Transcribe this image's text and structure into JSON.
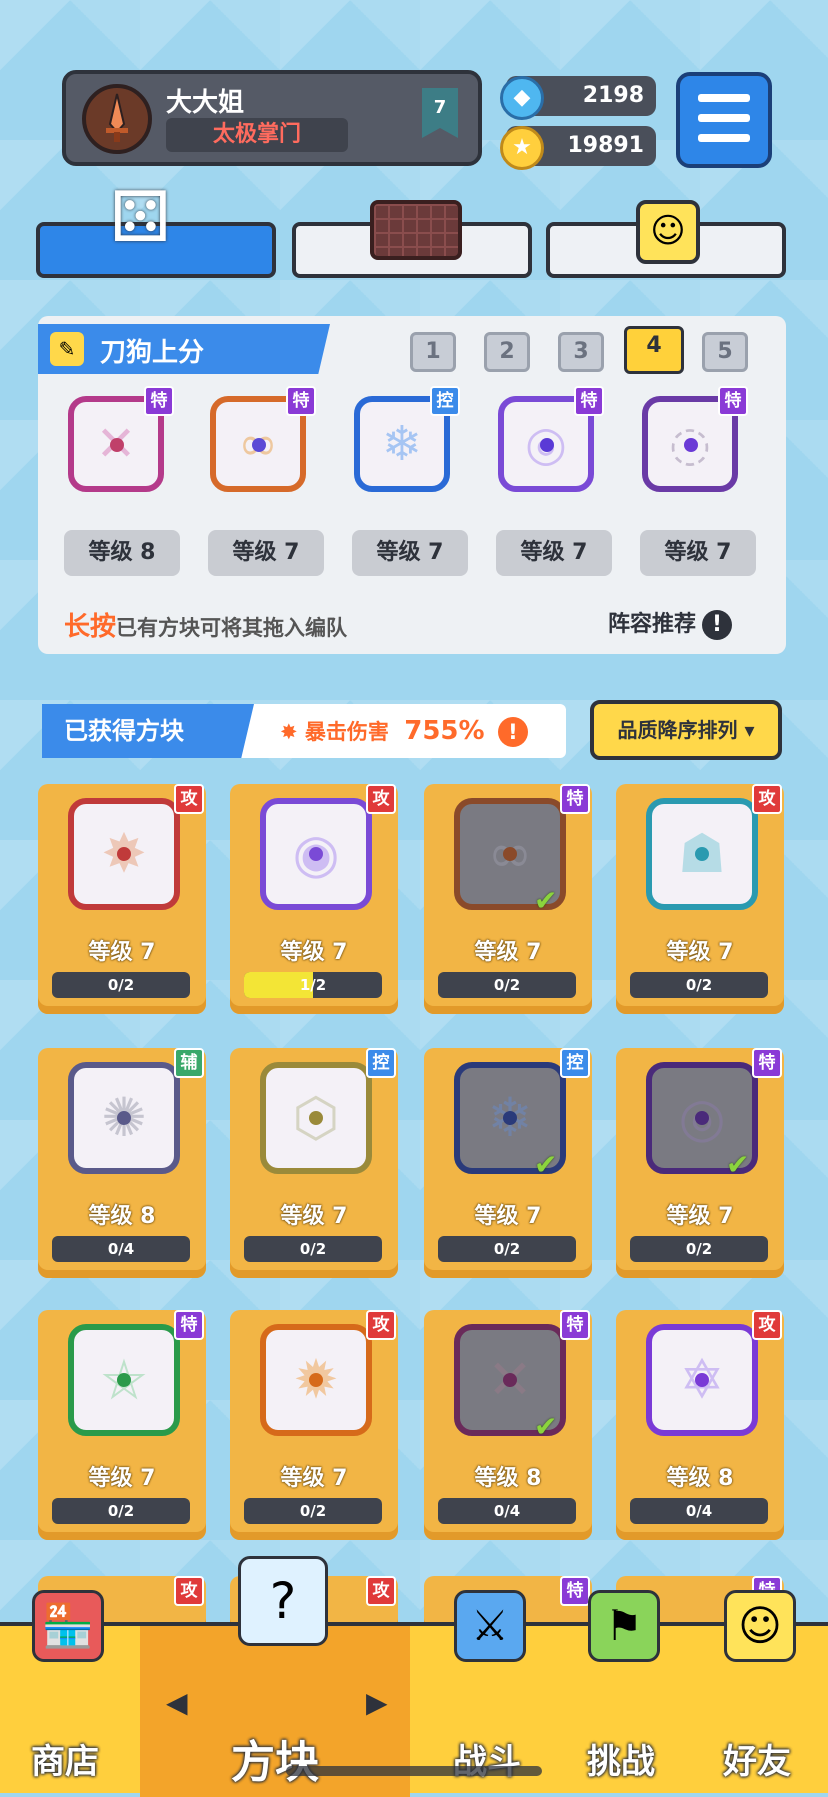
{
  "player": {
    "name": "大大姐",
    "title": "太极掌门",
    "rank": "7"
  },
  "resources": {
    "gems": "2198",
    "coins": "19891"
  },
  "colors": {
    "primary_blue": "#3b8bea",
    "card_orange": "#f2b545",
    "nav_yellow": "#ffcf3d"
  },
  "lineup": {
    "title": "刀狗上分",
    "deck_tabs": [
      "1",
      "2",
      "3",
      "4",
      "5"
    ],
    "active_deck": "4",
    "slots": [
      {
        "tag": "特",
        "level": "等级 8"
      },
      {
        "tag": "特",
        "level": "等级 7"
      },
      {
        "tag": "控",
        "level": "等级 7"
      },
      {
        "tag": "特",
        "level": "等级 7"
      },
      {
        "tag": "特",
        "level": "等级 7"
      }
    ],
    "hint_highlight": "长按",
    "hint_text": "已有方块可将其拖入编队",
    "recommend": "阵容推荐"
  },
  "owned": {
    "title": "已获得方块",
    "crit_label": "暴击伤害",
    "crit_value": "755%",
    "sort_label": "品质降序排列 ▾"
  },
  "cards": [
    {
      "tag": "攻",
      "level": "等级 7",
      "progress": "0/2",
      "fraction": 0
    },
    {
      "tag": "攻",
      "level": "等级 7",
      "progress": "1/2",
      "fraction": 0.5
    },
    {
      "tag": "特",
      "level": "等级 7",
      "progress": "0/2",
      "fraction": 0
    },
    {
      "tag": "攻",
      "level": "等级 7",
      "progress": "0/2",
      "fraction": 0
    },
    {
      "tag": "辅",
      "level": "等级 8",
      "progress": "0/4",
      "fraction": 0
    },
    {
      "tag": "控",
      "level": "等级 7",
      "progress": "0/2",
      "fraction": 0
    },
    {
      "tag": "控",
      "level": "等级 7",
      "progress": "0/2",
      "fraction": 0
    },
    {
      "tag": "特",
      "level": "等级 7",
      "progress": "0/2",
      "fraction": 0
    },
    {
      "tag": "特",
      "level": "等级 7",
      "progress": "0/2",
      "fraction": 0
    },
    {
      "tag": "攻",
      "level": "等级 7",
      "progress": "0/2",
      "fraction": 0
    },
    {
      "tag": "特",
      "level": "等级 8",
      "progress": "0/4",
      "fraction": 0
    },
    {
      "tag": "攻",
      "level": "等级 8",
      "progress": "0/4",
      "fraction": 0
    }
  ],
  "partial_row_tags": [
    "攻",
    "攻",
    "特",
    "特"
  ],
  "nav": {
    "shop": "商店",
    "blocks": "方块",
    "battle": "战斗",
    "challenge": "挑战",
    "friends": "好友"
  }
}
